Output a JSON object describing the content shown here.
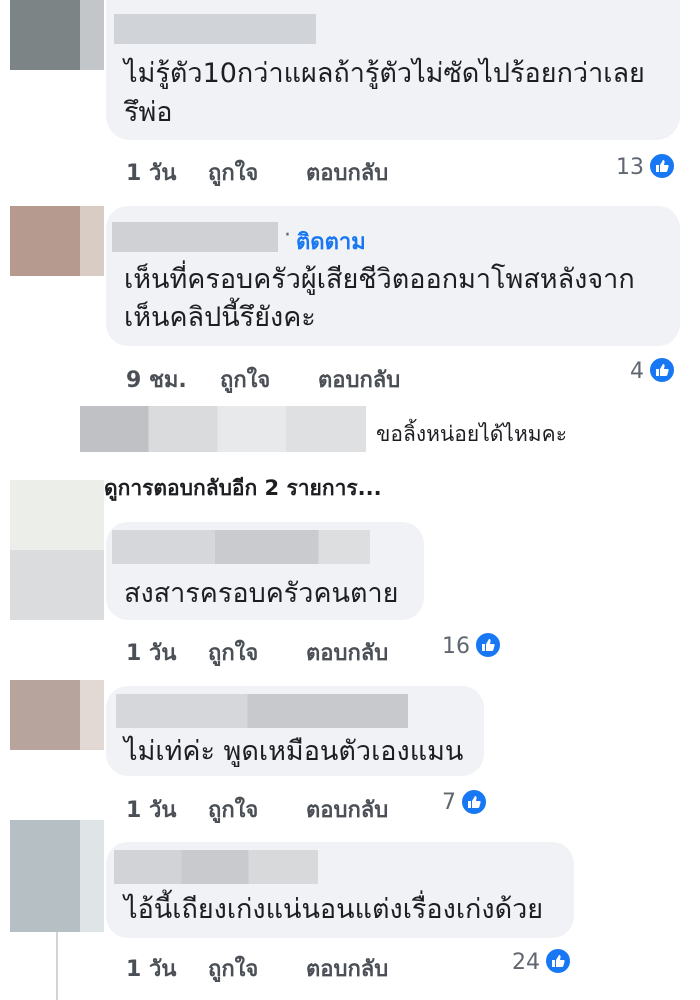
{
  "comments": [
    {
      "text_lines": [
        "ไม่รู้ตัว10กว่าแผลถ้ารู้ตัวไม่ซัดไปร้อยกว่าเลย",
        "รึพ่อ"
      ],
      "time": "1 วัน",
      "like_label": "ถูกใจ",
      "reply_label": "ตอบกลับ",
      "reactions": "13"
    },
    {
      "follow_label": "ติดตาม",
      "text_lines": [
        "เห็นที่ครอบครัวผู้เสียชีวิตออกมาโพสหลังจาก",
        "เห็นคลิปนี้รึยังคะ"
      ],
      "time": "9 ชม.",
      "like_label": "ถูกใจ",
      "reply_label": "ตอบกลับ",
      "reactions": "4"
    },
    {
      "text_lines": [
        "สงสารครอบครัวคนตาย"
      ],
      "time": "1 วัน",
      "like_label": "ถูกใจ",
      "reply_label": "ตอบกลับ",
      "reactions": "16"
    },
    {
      "text_lines": [
        "ไม่เท่ค่ะ พูดเหมือนตัวเองแมน"
      ],
      "time": "1 วัน",
      "like_label": "ถูกใจ",
      "reply_label": "ตอบกลับ",
      "reactions": "7"
    },
    {
      "text_lines": [
        "ไอ้นี้เถียงเก่งแน่นอนแต่งเรื่องเก่งด้วย"
      ],
      "time": "1 วัน",
      "like_label": "ถูกใจ",
      "reply_label": "ตอบกลับ",
      "reactions": "24"
    }
  ],
  "inline_reply": {
    "text": "ขอลิ้งหน่อยได้ไหมคะ"
  },
  "view_more_replies": "ดูการตอบกลับอีก 2 รายการ...",
  "colors": {
    "accent": "#1877f2",
    "bubble": "#f0f2f5"
  }
}
